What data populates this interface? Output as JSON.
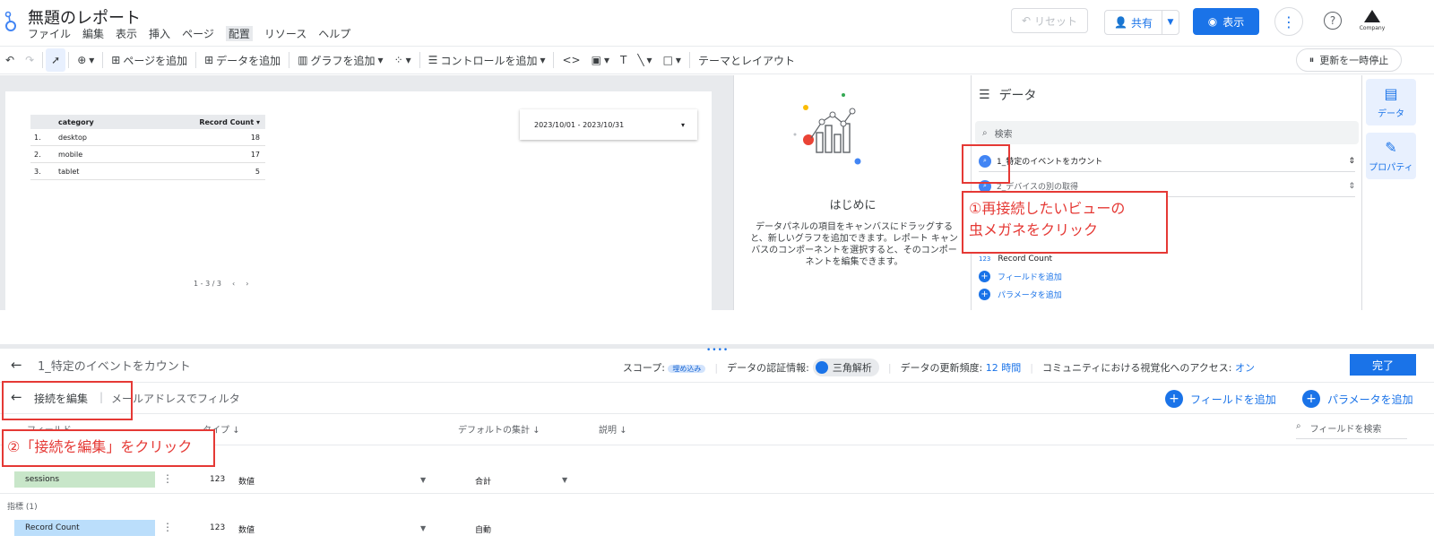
{
  "app": {
    "report_title": "無題のレポート",
    "menu": [
      "ファイル",
      "編集",
      "表示",
      "挿入",
      "ページ",
      "配置",
      "リソース",
      "ヘルプ"
    ],
    "active_menu": "配置",
    "reset_label": "リセット",
    "share_label": "共有",
    "view_label": "表示",
    "company_label": "Company"
  },
  "toolbar": {
    "add_page": "ページを追加",
    "add_data": "データを追加",
    "add_chart": "グラフを追加",
    "add_control": "コントロールを追加",
    "theme_layout": "テーマとレイアウト",
    "pause_updates": "更新を一時停止"
  },
  "report_table": {
    "headers": [
      "category",
      "Record Count"
    ],
    "rows": [
      {
        "n": "1.",
        "category": "desktop",
        "count": "18"
      },
      {
        "n": "2.",
        "category": "mobile",
        "count": "17"
      },
      {
        "n": "3.",
        "category": "tablet",
        "count": "5"
      }
    ],
    "pager": "1 - 3 / 3"
  },
  "date_control": {
    "range": "2023/10/01 - 2023/10/31"
  },
  "getting_started": {
    "title": "はじめに",
    "body": "データパネルの項目をキャンバスにドラッグすると、新しいグラフを追加できます。レポート キャンバスのコンポーネントを選択すると、そのコンポーネントを編集できます。"
  },
  "data_panel": {
    "title": "データ",
    "search_placeholder": "検索",
    "source_1": "1_特定のイベントをカウント",
    "source_2": "2_デバイスの別の取得",
    "field": "Record Count",
    "field_type": "123",
    "add_field": "フィールドを追加",
    "add_param": "パラメータを追加"
  },
  "rail": {
    "data": "データ",
    "properties": "プロパティ"
  },
  "editor": {
    "source_name": "1_特定のイベントをカウント",
    "scope_label": "スコープ:",
    "scope_chip": "埋め込み",
    "credentials_label": "データの認証情報:",
    "credentials_user": "三角解析",
    "freshness_label": "データの更新頻度:",
    "freshness_value": "12 時間",
    "community_label": "コミュニティにおける視覚化へのアクセス:",
    "community_value": "オン",
    "done": "完了",
    "edit_connection": "接続を編集",
    "filter_email": "メールアドレスでフィルタ",
    "add_field": "フィールドを追加",
    "add_param": "パラメータを追加",
    "col_field": "フィールド",
    "col_type": "タイプ",
    "col_agg": "デフォルトの集計",
    "col_desc": "説明",
    "search_fields": "フィールドを検索",
    "metrics_label": "指標 (1)",
    "rows": [
      {
        "name": "sessions",
        "type_num": "123",
        "type": "数値",
        "agg": "合計",
        "color": "#c8e6c9"
      },
      {
        "name": "Record Count",
        "type_num": "123",
        "type": "数値",
        "agg": "自動",
        "color": "#bbdefb"
      }
    ]
  },
  "annotations": {
    "note_1_line1": "①再接続したいビューの",
    "note_1_line2": "虫メガネをクリック",
    "note_2": "②「接続を編集」をクリック"
  },
  "colors": {
    "accent": "#1a73e8",
    "annotation": "#e53935",
    "dimension": "#c8e6c9",
    "metric": "#bbdefb"
  }
}
